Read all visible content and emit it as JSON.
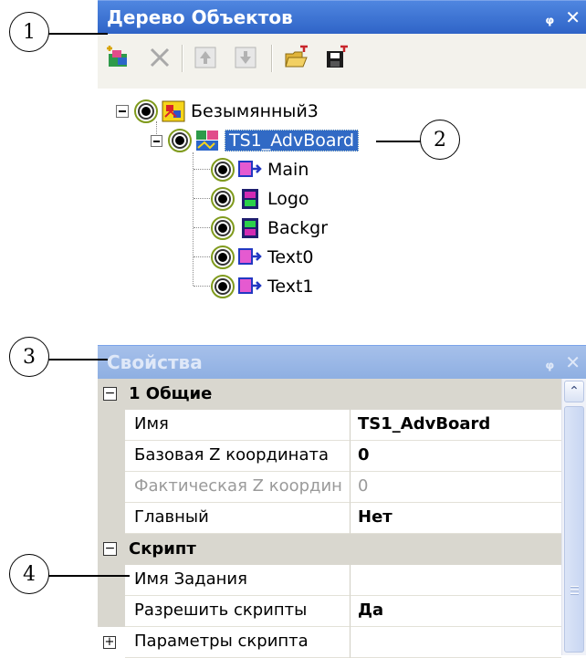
{
  "callouts": [
    "1",
    "2",
    "3",
    "4"
  ],
  "object_tree_panel": {
    "title": "Дерево Объектов",
    "pin_icon": "pin-icon",
    "close_icon": "close-icon",
    "toolbar": [
      "add-object-icon",
      "delete-icon",
      "move-up-icon",
      "move-down-icon",
      "open-folder-icon",
      "save-icon"
    ],
    "tree": {
      "root": "Безымянный3",
      "selected": "TS1_AdvBoard",
      "children": [
        "Main",
        "Logo",
        "Backgr",
        "Text0",
        "Text1"
      ]
    }
  },
  "properties_panel": {
    "title": "Свойства",
    "categories": [
      {
        "label": "1 Общие",
        "rows": [
          {
            "name": "Имя",
            "value": "TS1_AdvBoard"
          },
          {
            "name": "Базовая Z координата",
            "value": "0"
          },
          {
            "name": "Фактическая Z координ",
            "value": "0",
            "disabled": true
          },
          {
            "name": "Главный",
            "value": "Нет"
          }
        ]
      },
      {
        "label": "Скрипт",
        "rows": [
          {
            "name": "Имя Задания",
            "value": ""
          },
          {
            "name": "Разрешить скрипты",
            "value": "Да"
          },
          {
            "name": "Параметры скрипта",
            "value": ""
          }
        ]
      }
    ]
  },
  "colors": {
    "title_active": "#2f64c7",
    "title_inactive": "#8eafe2",
    "selection": "#316ac5",
    "category_bg": "#d9d7cf"
  }
}
